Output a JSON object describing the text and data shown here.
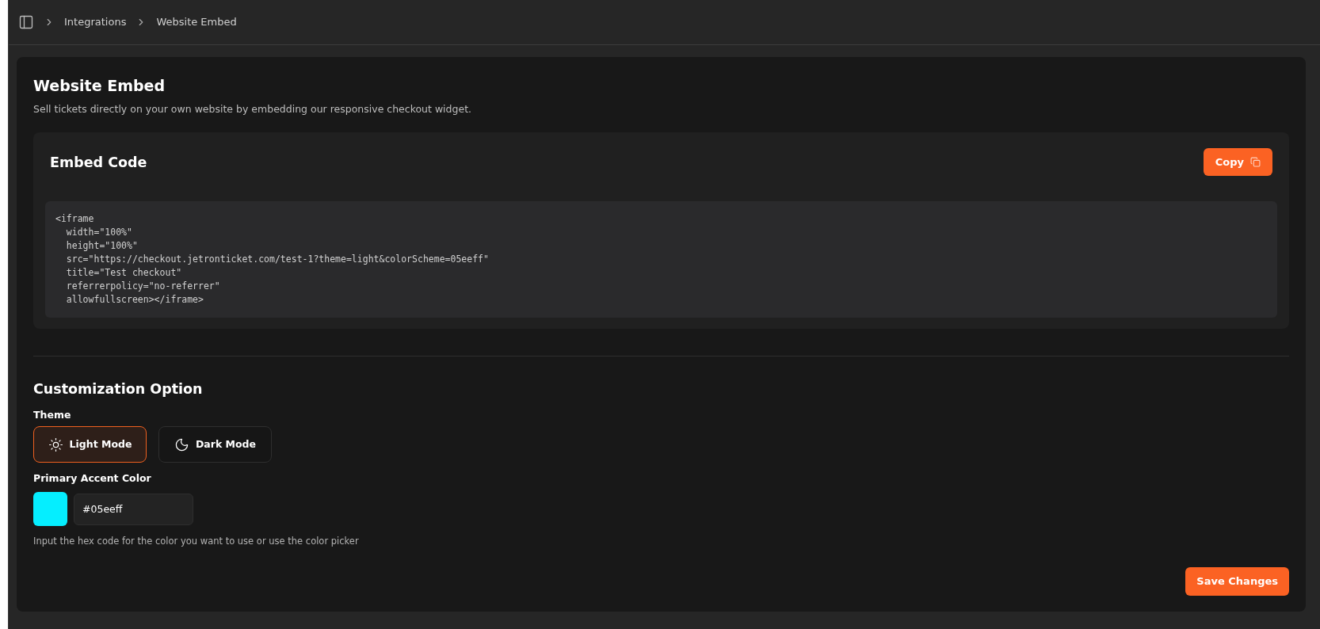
{
  "breadcrumb": [
    "Integrations",
    "Website Embed"
  ],
  "page": {
    "title": "Website Embed",
    "description": "Sell tickets directly on your own website by embedding our responsive checkout widget."
  },
  "embed": {
    "title": "Embed Code",
    "copy_label": "Copy",
    "code_lines": [
      "<iframe",
      "  width=\"100%\"",
      "  height=\"100%\"",
      "  src=\"https://checkout.jetronticket.com/test-1?theme=light&colorScheme=05eeff\"",
      "  title=\"Test checkout\"",
      "  referrerpolicy=\"no-referrer\"",
      "  allowfullscreen></iframe>"
    ]
  },
  "customization": {
    "title": "Customization Option",
    "theme_label": "Theme",
    "themes": [
      {
        "kind": "light",
        "label": "Light Mode",
        "selected": true
      },
      {
        "kind": "dark",
        "label": "Dark Mode",
        "selected": false
      }
    ],
    "accent_label": "Primary Accent Color",
    "accent_value": "#05eeff",
    "hint": "Input the hex code for the color you want to use or use the color picker"
  },
  "save_label": "Save Changes"
}
